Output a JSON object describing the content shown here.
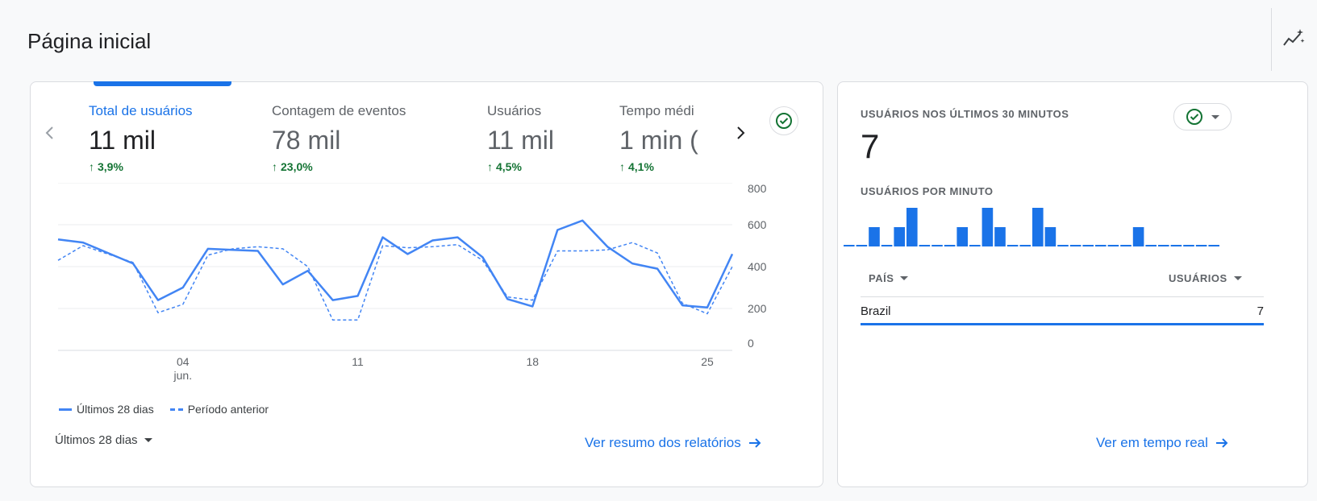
{
  "page": {
    "title": "Página inicial"
  },
  "icons": {
    "insights": "insights-sparkle-icon",
    "chevron_left": "chevron-left-icon",
    "chevron_right": "chevron-right-icon",
    "check": "check-circle-icon",
    "arrow_right": "arrow-right-icon",
    "caret": "caret-down-icon",
    "trend_up": "arrow-up-icon"
  },
  "colors": {
    "accent": "#1a73e8",
    "series": "#4285f4",
    "positive": "#137333",
    "bar": "#1a73e8"
  },
  "overview": {
    "metrics": [
      {
        "label": "Total de usuários",
        "value": "11 mil",
        "delta": "3,9%",
        "active": true
      },
      {
        "label": "Contagem de eventos",
        "value": "78 mil",
        "delta": "23,0%",
        "active": false
      },
      {
        "label": "Usuários",
        "value": "11 mil",
        "delta": "4,5%",
        "active": false
      },
      {
        "label": "Tempo médi",
        "value": "1 min (",
        "delta": "4,1%",
        "active": false
      }
    ],
    "legend": {
      "current": "Últimos 28 dias",
      "previous": "Período anterior"
    },
    "range_label": "Últimos 28 dias",
    "link": "Ver resumo dos relatórios"
  },
  "chart_data": {
    "type": "line",
    "x_ticks": [
      {
        "index": 5,
        "label": "04",
        "sublabel": "jun."
      },
      {
        "index": 12,
        "label": "11"
      },
      {
        "index": 19,
        "label": "18"
      },
      {
        "index": 26,
        "label": "25"
      }
    ],
    "y_ticks": [
      0,
      200,
      400,
      600,
      800
    ],
    "ylim": [
      0,
      800
    ],
    "grid": true,
    "legend_position": "bottom-left",
    "series": [
      {
        "name": "Últimos 28 dias",
        "style": "solid",
        "values": [
          530,
          515,
          465,
          415,
          240,
          300,
          485,
          480,
          475,
          315,
          380,
          240,
          260,
          540,
          460,
          525,
          540,
          445,
          245,
          210,
          575,
          620,
          495,
          415,
          390,
          215,
          205,
          460
        ]
      },
      {
        "name": "Período anterior",
        "style": "dashed",
        "values": [
          430,
          500,
          460,
          420,
          180,
          220,
          455,
          485,
          495,
          485,
          400,
          145,
          145,
          500,
          490,
          495,
          505,
          430,
          255,
          240,
          475,
          475,
          480,
          515,
          465,
          225,
          175,
          400
        ]
      }
    ]
  },
  "realtime": {
    "title": "USUÁRIOS NOS ÚLTIMOS 30 MINUTOS",
    "count": "7",
    "per_minute_label": "USUÁRIOS POR MINUTO",
    "per_minute": [
      0,
      0,
      1,
      0,
      1,
      2,
      0,
      0,
      0,
      1,
      0,
      2,
      1,
      0,
      0,
      2,
      1,
      0,
      0,
      0,
      0,
      0,
      0,
      1,
      0,
      0,
      0,
      0,
      0,
      0
    ],
    "table": {
      "col_country": "PAÍS",
      "col_users": "USUÁRIOS",
      "rows": [
        {
          "country": "Brazil",
          "users": "7"
        }
      ]
    },
    "link": "Ver em tempo real"
  }
}
